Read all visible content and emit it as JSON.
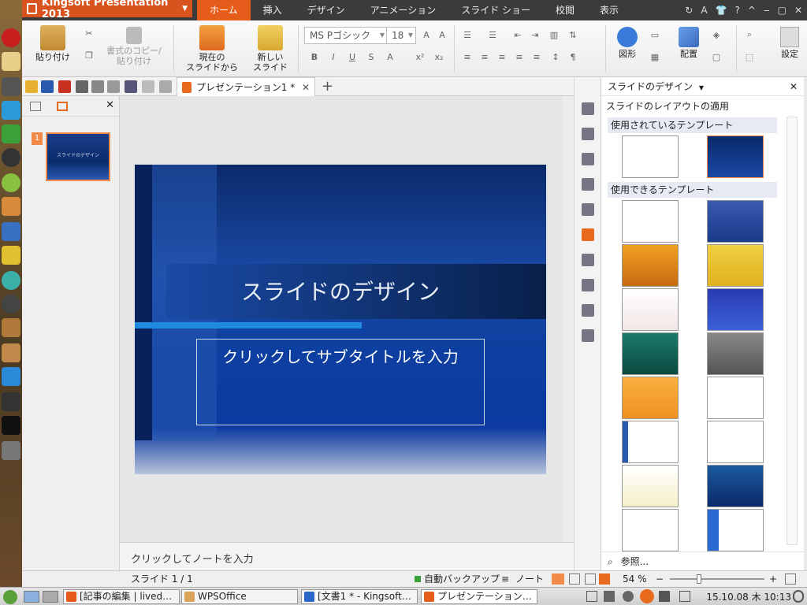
{
  "app": {
    "title": "Kingsoft Presentation 2013",
    "accent": "#e65c1a"
  },
  "ribbon_tabs": [
    "ホーム",
    "挿入",
    "デザイン",
    "アニメーション",
    "スライド ショー",
    "校閲",
    "表示"
  ],
  "title_icons": [
    "↻",
    "A",
    "👕",
    "?",
    "^",
    "‒",
    "▢",
    "✕"
  ],
  "ribbon": {
    "paste": "貼り付け",
    "format_copy_1": "書式のコピー/",
    "format_copy_2": "貼り付け",
    "from_current_1": "現在の",
    "from_current_2": "スライドから",
    "new_slide_1": "新しい",
    "new_slide_2": "スライド",
    "font_name": "MS Pゴシック",
    "font_size": "18",
    "shape": "図形",
    "arrange": "配置",
    "settings": "設定"
  },
  "doc_tab": {
    "title": "プレゼンテーション1 *"
  },
  "slide_panel": {
    "thumb_number": "1",
    "thumb_title": "スライドのデザイン"
  },
  "slide": {
    "title": "スライドのデザイン",
    "subtitle_placeholder": "クリックしてサブタイトルを入力"
  },
  "notes": {
    "placeholder": "クリックしてノートを入力"
  },
  "design_pane": {
    "title": "スライドのデザイン",
    "apply_layout": "スライドのレイアウトの適用",
    "used_templates": "使用されているテンプレート",
    "available_templates": "使用できるテンプレート",
    "browse": "参照..."
  },
  "status": {
    "slide_counter": "スライド 1 / 1",
    "auto_backup": "自動バックアップ",
    "notes": "ノート",
    "zoom": "54 %"
  },
  "taskbar": {
    "items": [
      {
        "label": "[記事の編集 | lived…",
        "color": "#e65a1a"
      },
      {
        "label": "WPSOffice",
        "color": "#d9a35a"
      },
      {
        "label": "[文書1 * - Kingsoft…",
        "color": "#2a66c8"
      },
      {
        "label": "プレゼンテーション…",
        "color": "#e65c1a"
      }
    ],
    "clock": "15.10.08 木 10:13"
  }
}
